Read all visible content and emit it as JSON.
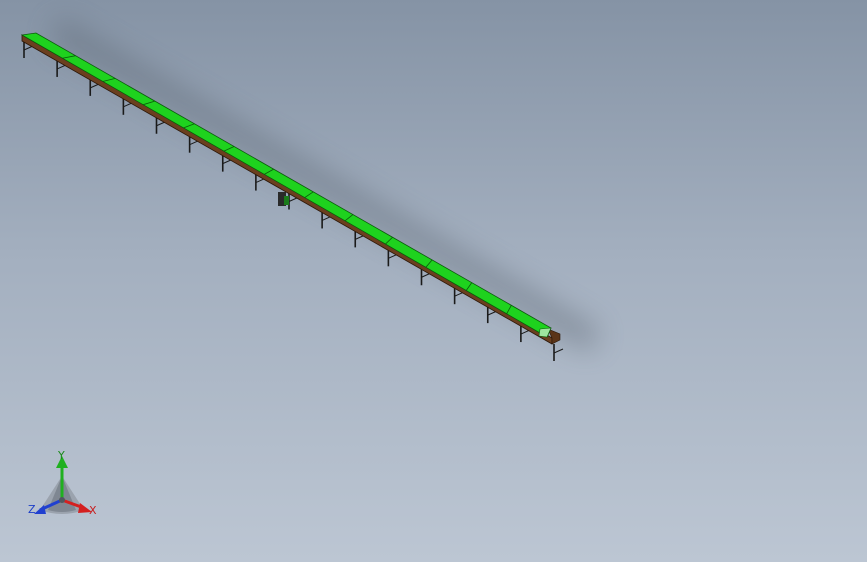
{
  "window": {
    "background_top": "#8593a5",
    "background_bottom": "#bcc6d3"
  },
  "model": {
    "name": "",
    "belt_color": "#1ed21e",
    "frame_color": "#6b3f1f",
    "leg_color": "#1a1a1a",
    "leg_count": 17
  },
  "triad": {
    "x_label": "X",
    "y_label": "Y",
    "z_label": "Z",
    "x_color": "#d42020",
    "y_color": "#20b020",
    "z_color": "#2040d0",
    "x_icon": "arrow-right-down-icon",
    "y_icon": "arrow-up-icon",
    "z_icon": "arrow-left-down-icon"
  }
}
